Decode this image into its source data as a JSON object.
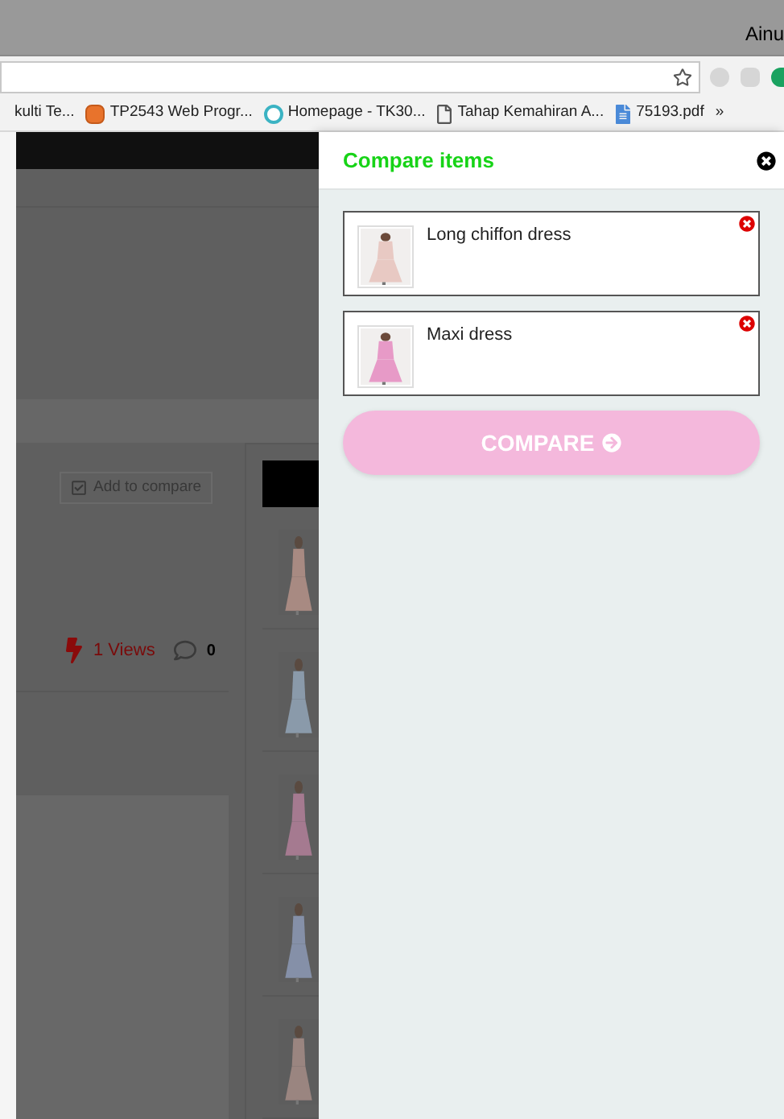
{
  "window": {
    "user": "Ainu"
  },
  "bookmarks": [
    {
      "label": "kulti Te...",
      "kind": "none"
    },
    {
      "label": "TP2543 Web Progr...",
      "kind": "app"
    },
    {
      "label": "Homepage - TK30...",
      "kind": "site"
    },
    {
      "label": "Tahap Kemahiran A...",
      "kind": "page"
    },
    {
      "label": "75193.pdf",
      "kind": "file"
    },
    {
      "label": "»",
      "kind": "more"
    }
  ],
  "page": {
    "add_to_compare": "Add to compare",
    "views": "1 Views",
    "comments": "0"
  },
  "compare_panel": {
    "title": "Compare items",
    "items": [
      {
        "name": "Long chiffon dress"
      },
      {
        "name": "Maxi dress"
      }
    ],
    "button": "COMPARE"
  }
}
